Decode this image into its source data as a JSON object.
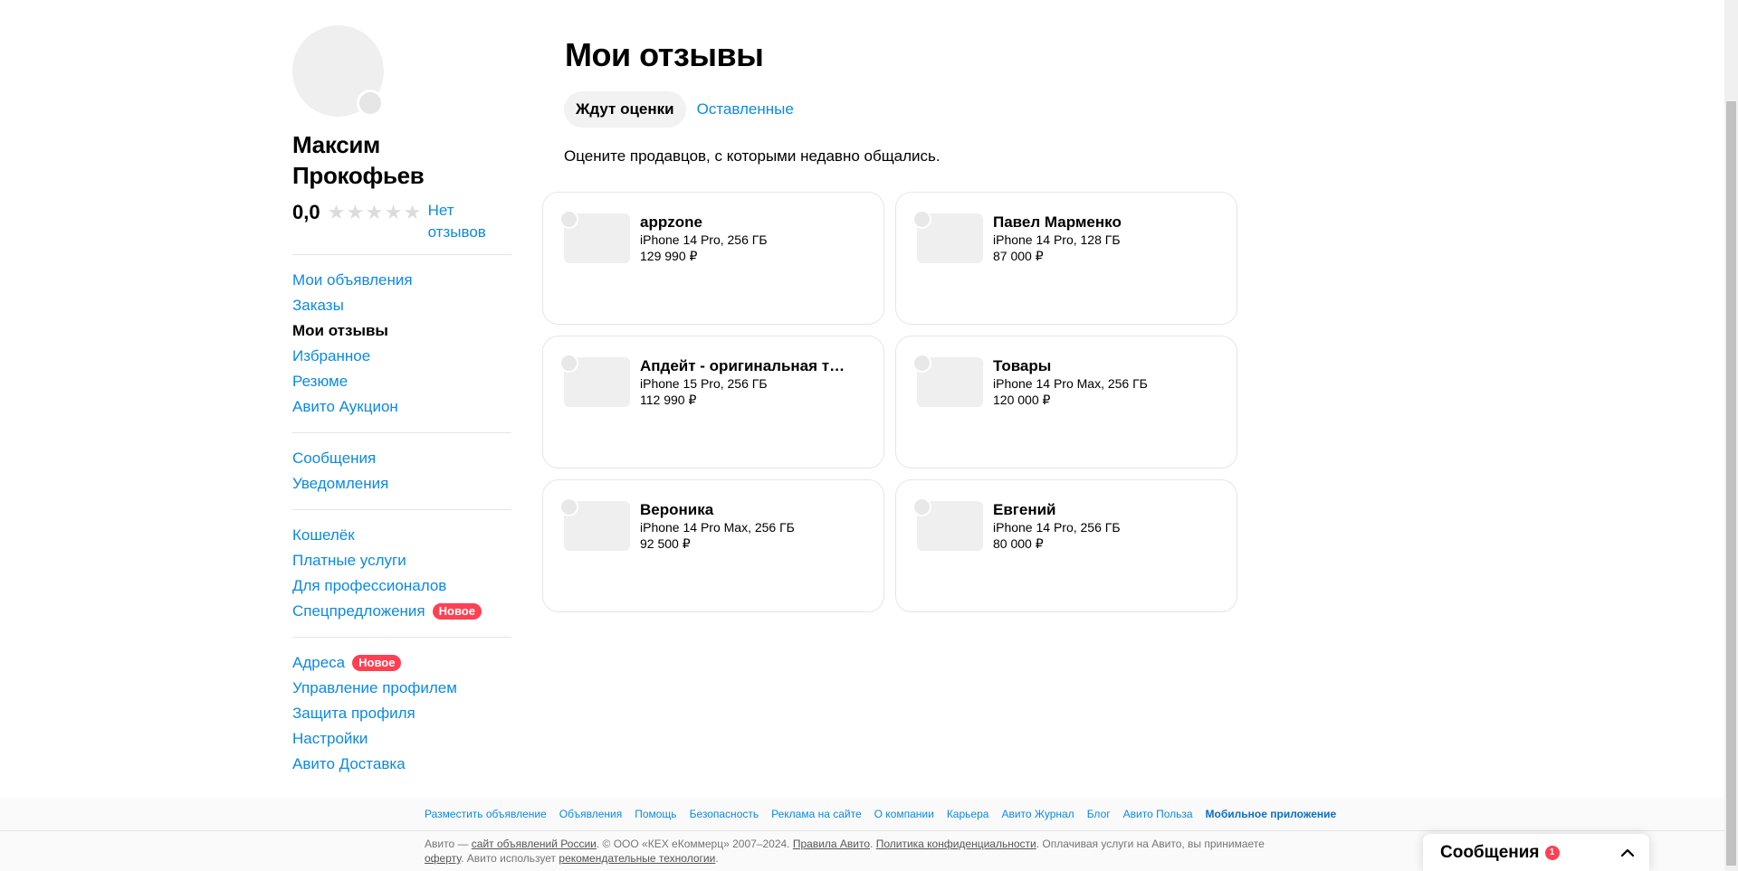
{
  "sidebar": {
    "name": "Максим Прокофьев",
    "rating_value": "0,0",
    "stars_filled": 0,
    "stars_total": 5,
    "reviews_link": "Нет отзывов",
    "groups": [
      [
        {
          "label": "Мои объявления"
        },
        {
          "label": "Заказы"
        },
        {
          "label": "Мои отзывы",
          "active": true
        },
        {
          "label": "Избранное"
        },
        {
          "label": "Резюме"
        },
        {
          "label": "Авито Аукцион"
        }
      ],
      [
        {
          "label": "Сообщения"
        },
        {
          "label": "Уведомления"
        }
      ],
      [
        {
          "label": "Кошелёк"
        },
        {
          "label": "Платные услуги"
        },
        {
          "label": "Для профессионалов"
        },
        {
          "label": "Спецпредложения",
          "badge": "Новое"
        }
      ],
      [
        {
          "label": "Адреса",
          "badge": "Новое"
        },
        {
          "label": "Управление профилем"
        },
        {
          "label": "Защита профиля"
        },
        {
          "label": "Настройки"
        },
        {
          "label": "Авито Доставка"
        }
      ]
    ]
  },
  "main": {
    "title": "Мои отзывы",
    "tabs": [
      {
        "label": "Ждут оценки",
        "active": true
      },
      {
        "label": "Оставленные",
        "active": false
      }
    ],
    "subtitle": "Оцените продавцов, с которыми недавно общались.",
    "cards": [
      {
        "name": "appzone",
        "model": "iPhone 14 Pro, 256 ГБ",
        "price": "129 990 ₽"
      },
      {
        "name": "Павел Марменко",
        "model": "iPhone 14 Pro, 128 ГБ",
        "price": "87 000 ₽"
      },
      {
        "name": "Апдейт - оригинальная те...",
        "model": "iPhone 15 Pro, 256 ГБ",
        "price": "112 990 ₽"
      },
      {
        "name": "Товары",
        "model": "iPhone 14 Pro Max, 256 ГБ",
        "price": "120 000 ₽"
      },
      {
        "name": "Вероника",
        "model": "iPhone 14 Pro Max, 256 ГБ",
        "price": "92 500 ₽"
      },
      {
        "name": "Евгений",
        "model": "iPhone 14 Pro, 256 ГБ",
        "price": "80 000 ₽"
      }
    ]
  },
  "footer": {
    "links": [
      "Разместить объявление",
      "Объявления",
      "Помощь",
      "Безопасность",
      "Реклама на сайте",
      "О компании",
      "Карьера",
      "Авито Журнал",
      "Блог",
      "Авито Польза"
    ],
    "app_link": "Мобильное приложение",
    "legal": [
      {
        "t": "Авито — "
      },
      {
        "t": "сайт объявлений России",
        "u": true
      },
      {
        "t": ". © ООО «КЕХ еКоммерц» 2007–2024. "
      },
      {
        "t": "Правила Авито",
        "u": true
      },
      {
        "t": ". "
      },
      {
        "t": "Политика конфиденциальности",
        "u": true
      },
      {
        "t": ". Оплачивая услуги на Авито, вы принимаете "
      },
      {
        "t": "оферту",
        "u": true
      },
      {
        "t": ". Авито использует "
      },
      {
        "t": "рекомендательные технологии",
        "u": true
      },
      {
        "t": "."
      }
    ]
  },
  "messenger": {
    "title": "Сообщения",
    "count": "1"
  },
  "colors": {
    "link": "#0a8ae6",
    "badge": "#ff4053"
  }
}
